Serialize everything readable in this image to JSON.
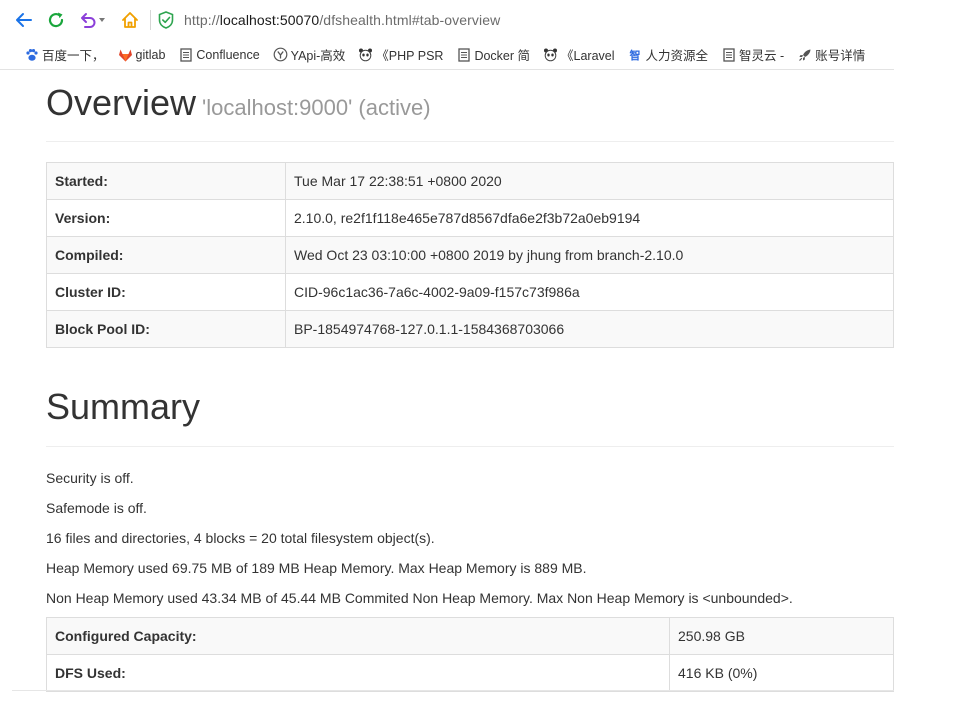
{
  "browser": {
    "url_prefix": "http://",
    "url_host": "localhost:50070",
    "url_path": "/dfshealth.html#tab-overview",
    "bookmarks": [
      {
        "label": "百度一下，",
        "icon": "baidu-paw-icon"
      },
      {
        "label": "gitlab",
        "icon": "gitlab-fox-icon"
      },
      {
        "label": "Confluence",
        "icon": "document-icon"
      },
      {
        "label": "YApi-高效",
        "icon": "yapi-icon"
      },
      {
        "label": "《PHP PSR",
        "icon": "panda-icon"
      },
      {
        "label": "Docker 简",
        "icon": "document-icon"
      },
      {
        "label": "《Laravel",
        "icon": "panda-icon"
      },
      {
        "label": "人力资源全",
        "icon": "zhi-icon"
      },
      {
        "label": "智灵云 -",
        "icon": "document-icon"
      },
      {
        "label": "账号详情",
        "icon": "rocket-icon"
      }
    ],
    "colors": {
      "back": "#1a73e8",
      "refresh": "#1aa63c",
      "undo": "#8b3fd9",
      "home": "#f0a000",
      "shield": "#2ea44f"
    }
  },
  "overview": {
    "title": "Overview",
    "subtitle": "'localhost:9000' (active)",
    "rows": [
      {
        "key": "Started:",
        "value": "Tue Mar 17 22:38:51 +0800 2020"
      },
      {
        "key": "Version:",
        "value": "2.10.0, re2f1f118e465e787d8567dfa6e2f3b72a0eb9194"
      },
      {
        "key": "Compiled:",
        "value": "Wed Oct 23 03:10:00 +0800 2019 by jhung from branch-2.10.0"
      },
      {
        "key": "Cluster ID:",
        "value": "CID-96c1ac36-7a6c-4002-9a09-f157c73f986a"
      },
      {
        "key": "Block Pool ID:",
        "value": "BP-1854974768-127.0.1.1-1584368703066"
      }
    ]
  },
  "summary": {
    "title": "Summary",
    "lines": [
      "Security is off.",
      "Safemode is off.",
      "16 files and directories, 4 blocks = 20 total filesystem object(s).",
      "Heap Memory used 69.75 MB of 189 MB Heap Memory. Max Heap Memory is 889 MB.",
      "Non Heap Memory used 43.34 MB of 45.44 MB Commited Non Heap Memory. Max Non Heap Memory is <unbounded>."
    ],
    "rows": [
      {
        "key": "Configured Capacity:",
        "value": "250.98 GB"
      },
      {
        "key": "DFS Used:",
        "value": "416 KB (0%)"
      }
    ]
  }
}
